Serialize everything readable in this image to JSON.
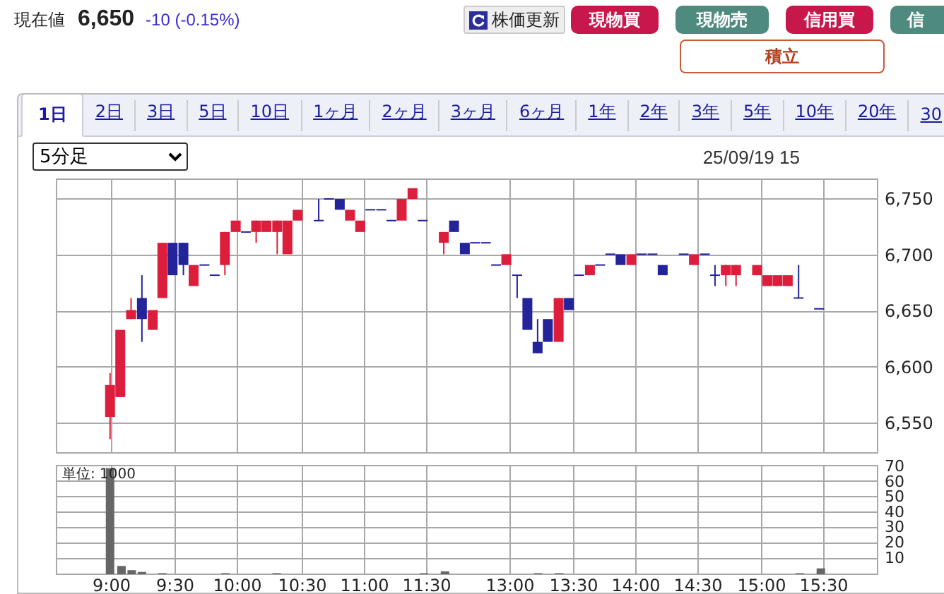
{
  "header": {
    "label": "現在値",
    "price": "6,650",
    "change": "-10 (-0.15%)"
  },
  "buttons": [
    {
      "label": "株価更新",
      "kind": "refresh"
    },
    {
      "label": "現物買",
      "kind": "buy"
    },
    {
      "label": "現物売",
      "kind": "sell"
    },
    {
      "label": "信用買",
      "kind": "buy"
    },
    {
      "label": "信",
      "kind": "sell"
    }
  ],
  "accumulate_button": {
    "label": "積立"
  },
  "tabs": [
    {
      "label": "1日",
      "selected": true
    },
    {
      "label": "2日",
      "selected": false
    },
    {
      "label": "3日",
      "selected": false
    },
    {
      "label": "5日",
      "selected": false
    },
    {
      "label": "10日",
      "selected": false
    },
    {
      "label": "1ヶ月",
      "selected": false
    },
    {
      "label": "2ヶ月",
      "selected": false
    },
    {
      "label": "3ヶ月",
      "selected": false
    },
    {
      "label": "6ヶ月",
      "selected": false
    },
    {
      "label": "1年",
      "selected": false
    },
    {
      "label": "2年",
      "selected": false
    },
    {
      "label": "3年",
      "selected": false
    },
    {
      "label": "5年",
      "selected": false
    },
    {
      "label": "10年",
      "selected": false
    },
    {
      "label": "20年",
      "selected": false
    },
    {
      "label": "30",
      "selected": false
    }
  ],
  "interval_select": {
    "value": "5分足"
  },
  "timestamp": "25/09/19 15",
  "price_axis": [
    "6,750",
    "6,700",
    "6,650",
    "6,600",
    "6,550"
  ],
  "time_axis": [
    "9:00",
    "9:30",
    "10:00",
    "10:30",
    "11:00",
    "11:30",
    "13:00",
    "13:30",
    "14:00",
    "14:30",
    "15:00",
    "15:30"
  ],
  "volume": {
    "unit": "単位: 1000",
    "axis": [
      "70",
      "60",
      "50",
      "40",
      "30",
      "20",
      "10"
    ]
  }
}
